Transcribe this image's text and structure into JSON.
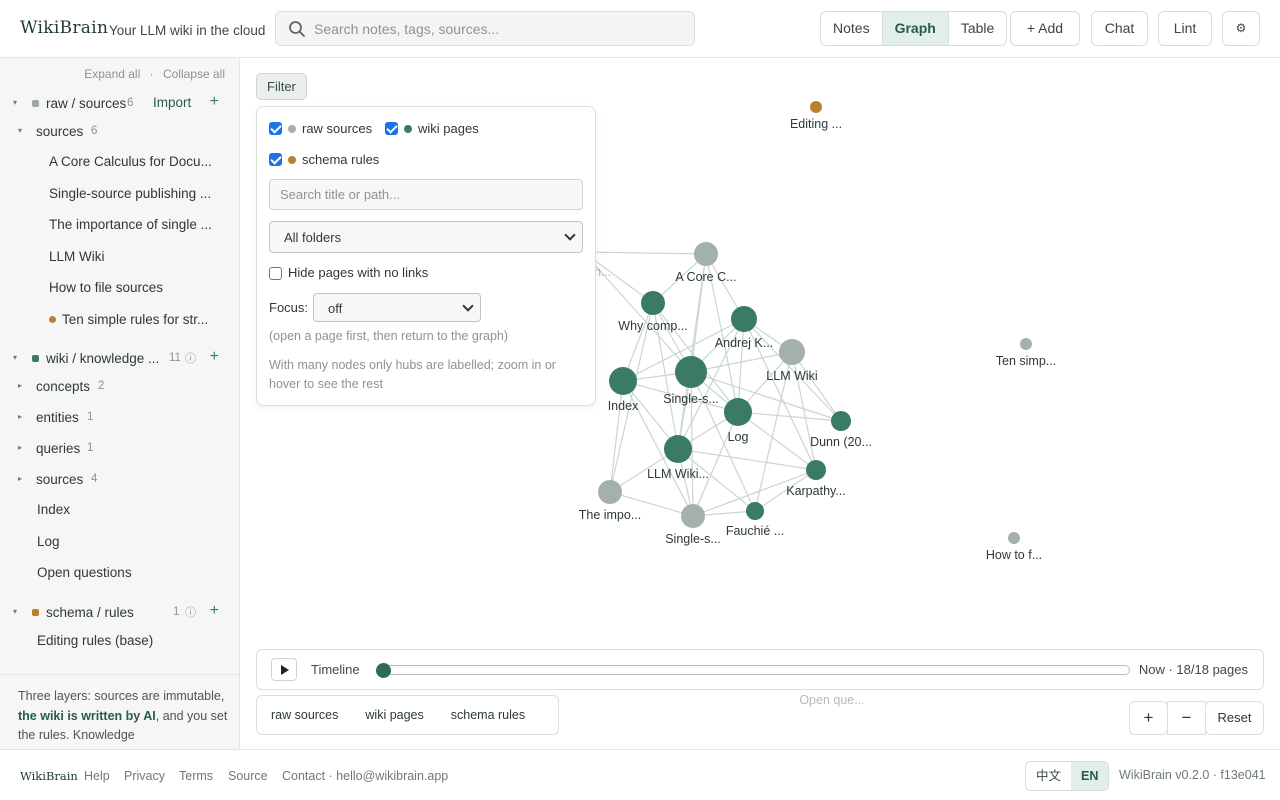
{
  "header": {
    "brand": "WikiBrain",
    "tagline": "Your LLM wiki in the cloud",
    "search_placeholder": "Search notes, tags, sources...",
    "views": [
      "Notes",
      "Graph",
      "Table"
    ],
    "active_view": "Graph",
    "add_label": "+ Add",
    "chat_label": "Chat",
    "lint_label": "Lint",
    "settings_icon": "⚙"
  },
  "sidebar": {
    "expand_all": "Expand all",
    "separator": "·",
    "collapse_all": "Collapse all",
    "raw": {
      "label": "raw / sources",
      "count": "6",
      "import_label": "Import",
      "plus": "+",
      "color": "#9aa8a1",
      "folder": {
        "label": "sources",
        "count": "6"
      },
      "items": [
        "A Core Calculus for Docu...",
        "Single-source publishing ...",
        "The importance of single ...",
        "LLM Wiki",
        "How to file sources",
        "Ten simple rules for str..."
      ]
    },
    "wiki": {
      "label": "wiki / knowledge ...",
      "count": "11",
      "info": "ⓘ",
      "plus": "+",
      "color": "#3a7a62",
      "folders": [
        {
          "label": "concepts",
          "count": "2"
        },
        {
          "label": "entities",
          "count": "1"
        },
        {
          "label": "queries",
          "count": "1"
        },
        {
          "label": "sources",
          "count": "4"
        }
      ],
      "pages": [
        "Index",
        "Log",
        "Open questions"
      ]
    },
    "schema": {
      "label": "schema / rules",
      "count": "1",
      "info": "ⓘ",
      "plus": "+",
      "color": "#b8802f",
      "items": [
        "Editing rules (base)"
      ]
    },
    "note_before": "Three layers: sources are immutable, ",
    "note_bold": "the wiki is written by AI",
    "note_after": ", and you set the rules. Knowledge"
  },
  "filter": {
    "button_label": "Filter",
    "raw_label": "raw sources",
    "wiki_label": "wiki pages",
    "schema_label": "schema rules",
    "search_placeholder": "Search title or path...",
    "folder_select": "All folders",
    "hide_label": "Hide pages with no links",
    "focus_label": "Focus:",
    "focus_value": "off",
    "help1": "(open a page first, then return to the graph)",
    "help2": "With many nodes only hubs are labelled; zoom in or hover to see the rest"
  },
  "graph": {
    "colors": {
      "raw": "#a3b0ab",
      "wiki": "#3b7a64",
      "schema": "#b8802f",
      "edge": "#c9d6d1"
    },
    "nodes": [
      {
        "id": "editing",
        "label": "Editing ...",
        "type": "schema"
      },
      {
        "id": "crichton",
        "label": "Crichton...",
        "type": "raw",
        "faded": true
      },
      {
        "id": "acore",
        "label": "A Core C...",
        "type": "raw"
      },
      {
        "id": "whycomp",
        "label": "Why comp...",
        "type": "wiki"
      },
      {
        "id": "andrej",
        "label": "Andrej K...",
        "type": "wiki"
      },
      {
        "id": "llmwiki",
        "label": "LLM Wiki",
        "type": "raw"
      },
      {
        "id": "index",
        "label": "Index",
        "type": "wiki"
      },
      {
        "id": "singles",
        "label": "Single-s...",
        "type": "wiki"
      },
      {
        "id": "log",
        "label": "Log",
        "type": "wiki"
      },
      {
        "id": "dunn",
        "label": "Dunn (20...",
        "type": "wiki"
      },
      {
        "id": "llmwikip",
        "label": "LLM Wiki...",
        "type": "wiki"
      },
      {
        "id": "karpathy",
        "label": "Karpathy...",
        "type": "wiki"
      },
      {
        "id": "theimpo",
        "label": "The impo...",
        "type": "raw"
      },
      {
        "id": "singles2",
        "label": "Single-s...",
        "type": "raw"
      },
      {
        "id": "fauchie",
        "label": "Fauchié ...",
        "type": "wiki"
      },
      {
        "id": "tensimp",
        "label": "Ten simp...",
        "type": "raw"
      },
      {
        "id": "howto",
        "label": "How to f...",
        "type": "raw"
      },
      {
        "id": "openque",
        "label": "Open que...",
        "type": "raw",
        "faded": true
      }
    ],
    "edges": [
      [
        "crichton",
        "acore"
      ],
      [
        "crichton",
        "whycomp"
      ],
      [
        "crichton",
        "singles"
      ],
      [
        "acore",
        "whycomp"
      ],
      [
        "acore",
        "singles"
      ],
      [
        "acore",
        "log"
      ],
      [
        "acore",
        "llmwikip"
      ],
      [
        "acore",
        "andrej"
      ],
      [
        "whycomp",
        "index"
      ],
      [
        "whycomp",
        "singles"
      ],
      [
        "whycomp",
        "log"
      ],
      [
        "whycomp",
        "llmwikip"
      ],
      [
        "whycomp",
        "theimpo"
      ],
      [
        "andrej",
        "llmwiki"
      ],
      [
        "andrej",
        "singles"
      ],
      [
        "andrej",
        "log"
      ],
      [
        "andrej",
        "dunn"
      ],
      [
        "andrej",
        "llmwikip"
      ],
      [
        "andrej",
        "karpathy"
      ],
      [
        "llmwiki",
        "singles"
      ],
      [
        "llmwiki",
        "log"
      ],
      [
        "llmwiki",
        "karpathy"
      ],
      [
        "llmwiki",
        "dunn"
      ],
      [
        "llmwiki",
        "fauchie"
      ],
      [
        "index",
        "singles"
      ],
      [
        "index",
        "log"
      ],
      [
        "index",
        "llmwikip"
      ],
      [
        "index",
        "theimpo"
      ],
      [
        "index",
        "singles2"
      ],
      [
        "index",
        "andrej"
      ],
      [
        "singles",
        "log"
      ],
      [
        "singles",
        "llmwikip"
      ],
      [
        "singles",
        "fauchie"
      ],
      [
        "singles",
        "dunn"
      ],
      [
        "singles",
        "singles2"
      ],
      [
        "log",
        "llmwikip"
      ],
      [
        "log",
        "dunn"
      ],
      [
        "log",
        "karpathy"
      ],
      [
        "log",
        "singles2"
      ],
      [
        "llmwikip",
        "karpathy"
      ],
      [
        "llmwikip",
        "theimpo"
      ],
      [
        "llmwikip",
        "singles2"
      ],
      [
        "llmwikip",
        "fauchie"
      ],
      [
        "karpathy",
        "fauchie"
      ],
      [
        "karpathy",
        "singles2"
      ],
      [
        "theimpo",
        "singles2"
      ],
      [
        "singles2",
        "fauchie"
      ]
    ]
  },
  "timeline": {
    "label": "Timeline",
    "now_label": "Now · 18/18 pages",
    "position": 0
  },
  "legend": [
    "raw sources",
    "wiki pages",
    "schema rules"
  ],
  "zoom": {
    "plus": "+",
    "minus": "−",
    "reset": "Reset"
  },
  "footer": {
    "brand": "WikiBrain",
    "links": [
      "Help",
      "Privacy",
      "Terms",
      "Source"
    ],
    "contact": "Contact · hello@wikibrain.app",
    "languages": [
      "中文",
      "EN"
    ],
    "active_language": "EN",
    "version": "WikiBrain v0.2.0 · f13e041"
  }
}
